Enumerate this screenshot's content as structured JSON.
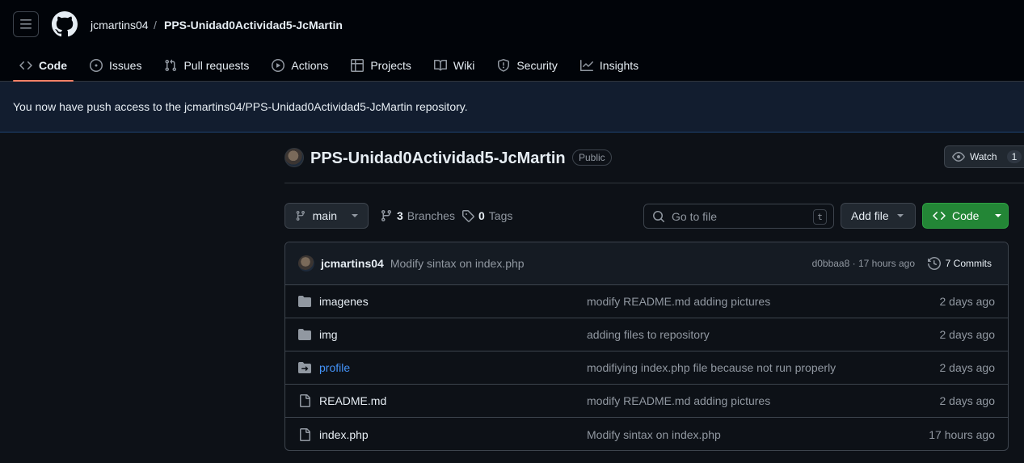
{
  "header": {
    "owner": "jcmartins04",
    "separator": "/",
    "repo": "PPS-Unidad0Actividad5-JcMartin"
  },
  "tabs": [
    {
      "label": "Code",
      "icon": "code-icon",
      "active": true
    },
    {
      "label": "Issues",
      "icon": "issue-icon"
    },
    {
      "label": "Pull requests",
      "icon": "pull-request-icon"
    },
    {
      "label": "Actions",
      "icon": "play-icon"
    },
    {
      "label": "Projects",
      "icon": "table-icon"
    },
    {
      "label": "Wiki",
      "icon": "book-icon"
    },
    {
      "label": "Security",
      "icon": "shield-icon"
    },
    {
      "label": "Insights",
      "icon": "graph-icon"
    }
  ],
  "flash": {
    "message": "You now have push access to the jcmartins04/PPS-Unidad0Actividad5-JcMartin repository."
  },
  "repo": {
    "title": "PPS-Unidad0Actividad5-JcMartin",
    "visibility": "Public",
    "watch_label": "Watch",
    "watch_count": "1"
  },
  "toolbar": {
    "branch": "main",
    "branches_count": "3",
    "branches_label": "Branches",
    "tags_count": "0",
    "tags_label": "Tags",
    "search_placeholder": "Go to file",
    "search_shortcut": "t",
    "add_file_label": "Add file",
    "code_label": "Code"
  },
  "commit": {
    "author": "jcmartins04",
    "message": "Modify sintax on index.php",
    "meta": "d0bbaa8 · 17 hours ago",
    "commits_label": "7 Commits"
  },
  "files": [
    {
      "name": "imagenes",
      "type": "folder",
      "message": "modify README.md adding pictures",
      "age": "2 days ago"
    },
    {
      "name": "img",
      "type": "folder",
      "message": "adding files to repository",
      "age": "2 days ago"
    },
    {
      "name": "profile",
      "type": "submodule",
      "message": "modifiying index.php file because not run properly",
      "age": "2 days ago"
    },
    {
      "name": "README.md",
      "type": "file",
      "message": "modify README.md adding pictures",
      "age": "2 days ago"
    },
    {
      "name": "index.php",
      "type": "file",
      "message": "Modify sintax on index.php",
      "age": "17 hours ago"
    }
  ],
  "colors": {
    "background": "#0d1117",
    "accent_tab": "#f78166",
    "code_button": "#238636",
    "link": "#4493f8"
  }
}
